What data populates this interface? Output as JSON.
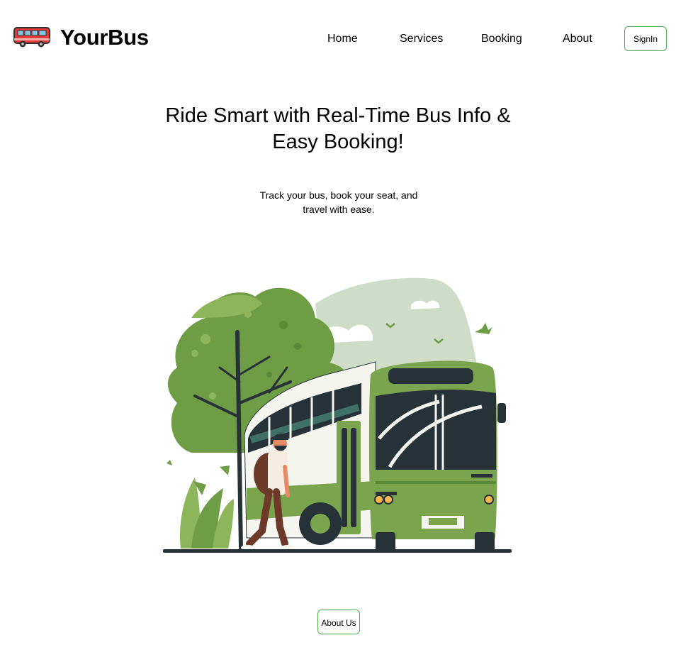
{
  "brand": {
    "name": "YourBus",
    "logo_icon": "bus-icon"
  },
  "nav": {
    "home": "Home",
    "services": "Services",
    "booking": "Booking",
    "about": "About"
  },
  "signin_label": "SignIn",
  "hero": {
    "title": "Ride Smart with Real-Time Bus Info & Easy Booking!",
    "subtitle": "Track your bus, book your seat, and travel with ease.",
    "illustration": "bus-traveler-illustration"
  },
  "about_button_label": "About Us",
  "colors": {
    "accent_border": "#4caf50",
    "bus_green": "#7aa54e",
    "tree_green": "#6e9d45",
    "logo_red": "#e53935"
  }
}
